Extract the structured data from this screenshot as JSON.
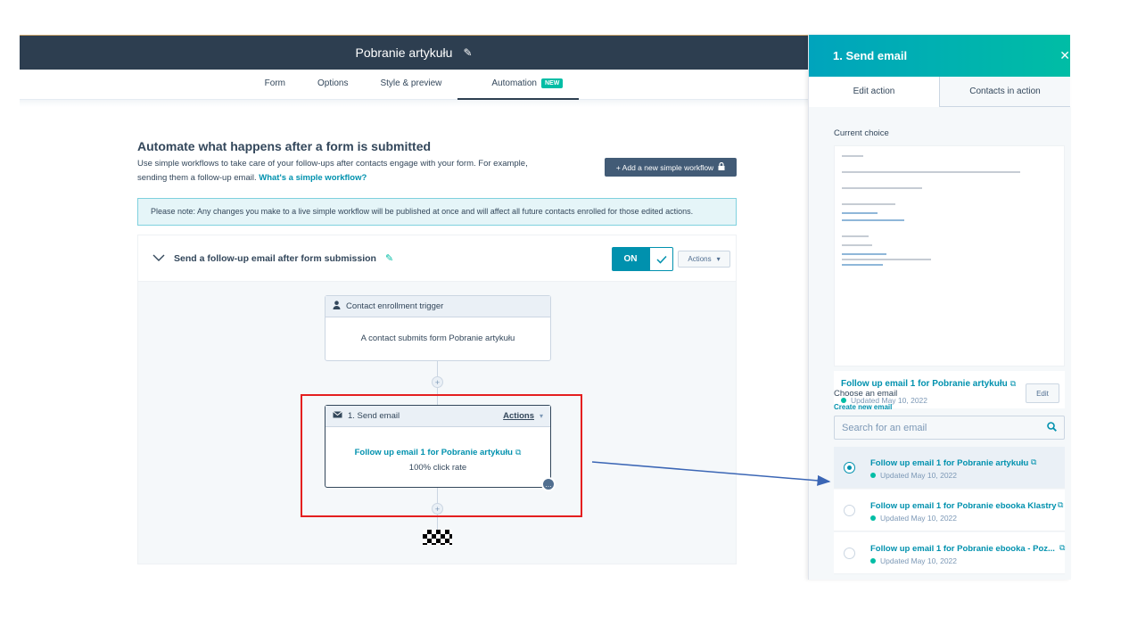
{
  "header": {
    "title": "Pobranie artykułu"
  },
  "tabs": [
    {
      "label": "Form"
    },
    {
      "label": "Options"
    },
    {
      "label": "Style & preview"
    },
    {
      "label": "Automation",
      "badge": "NEW"
    }
  ],
  "intro": {
    "title": "Automate what happens after a form is submitted",
    "description": "Use simple workflows to take care of your follow-ups after contacts engage with your form. For example, sending them a follow-up email.",
    "link": "What's a simple workflow?",
    "add_button": "+ Add a new simple workflow"
  },
  "note": "Please note: Any changes you make to a live simple workflow will be published at once and will affect all future contacts enrolled for those edited actions.",
  "workflow": {
    "title": "Send a follow-up email after form submission",
    "toggle_label": "ON",
    "actions_label": "Actions",
    "trigger": {
      "title": "Contact enrollment trigger",
      "body": "A contact submits form Pobranie artykułu"
    },
    "action": {
      "title": "1. Send email",
      "actions_label": "Actions",
      "email": "Follow up email 1 for Pobranie artykułu",
      "stat": "100% click rate"
    }
  },
  "panel": {
    "title": "1. Send email",
    "tabs": [
      {
        "label": "Edit action"
      },
      {
        "label": "Contacts in action"
      }
    ],
    "current_choice_label": "Current choice",
    "current": {
      "email": "Follow up email 1 for Pobranie artykułu",
      "updated": "Updated May 10, 2022",
      "edit_label": "Edit"
    },
    "choose_label": "Choose an email",
    "create_label": "Create new email",
    "search_placeholder": "Search for an email",
    "options": [
      {
        "email": "Follow up email 1 for Pobranie artykułu",
        "updated": "Updated May 10, 2022",
        "selected": true
      },
      {
        "email": "Follow up email 1 for Pobranie ebooka Klastry",
        "updated": "Updated May 10, 2022",
        "selected": false
      },
      {
        "email": "Follow up email 1 for Pobranie ebooka - Poz...",
        "updated": "Updated May 10, 2022",
        "selected": false
      }
    ]
  },
  "colors": {
    "accent": "#0091ae",
    "header": "#2d3e50",
    "highlight": "#e41f1f",
    "arrow": "#3b66b5"
  }
}
